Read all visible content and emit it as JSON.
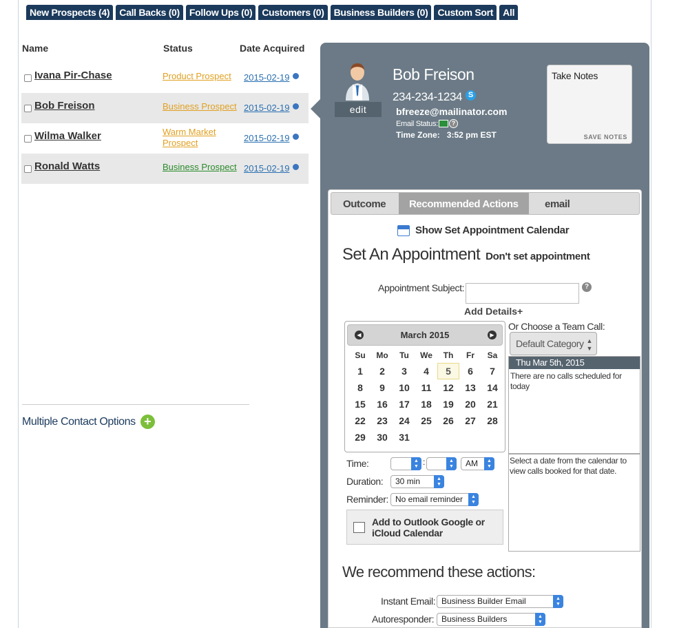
{
  "tabs": [
    {
      "label": "New Prospects (4)"
    },
    {
      "label": "Call Backs (0)"
    },
    {
      "label": "Follow Ups (0)"
    },
    {
      "label": "Customers (0)"
    },
    {
      "label": "Business Builders (0)"
    },
    {
      "label": "Custom Sort"
    },
    {
      "label": "All"
    }
  ],
  "columns": {
    "name": "Name",
    "status": "Status",
    "date": "Date Acquired"
  },
  "contacts": [
    {
      "name": "Ivana Pir-Chase",
      "status": "Product Prospect",
      "status_color": "#e0a020",
      "date": "2015-02-19"
    },
    {
      "name": "Bob Freison",
      "status": "Business Prospect",
      "status_color": "#e0a020",
      "date": "2015-02-19"
    },
    {
      "name": "Wilma Walker",
      "status": "Warm Market Prospect",
      "status_color": "#e0a020",
      "date": "2015-02-19"
    },
    {
      "name": "Ronald Watts",
      "status": "Business Prospect",
      "status_color": "#2a8a2a",
      "date": "2015-02-19"
    }
  ],
  "multiple_contact_options": "Multiple Contact Options",
  "contact": {
    "edit_label": "edit",
    "name": "Bob Freison",
    "phone": "234-234-1234",
    "email": "bfreeze@mailinator.com",
    "email_status_label": "Email Status:",
    "time_zone_label": "Time Zone:",
    "time_zone_value": "3:52 pm EST"
  },
  "notes": {
    "placeholder": "Take Notes",
    "save_label": "SAVE NOTES"
  },
  "subtabs": [
    {
      "label": "Outcome"
    },
    {
      "label": "Recommended Actions"
    },
    {
      "label": "email"
    }
  ],
  "show_calendar_label": "Show Set Appointment Calendar",
  "appointment": {
    "title": "Set An Appointment",
    "dont_set": "Don't set appointment",
    "subject_label": "Appointment Subject:",
    "add_details": "Add Details+",
    "team_call_label": "Or Choose a Team Call:",
    "team_category": "Default Category",
    "calls_date": "Thu Mar 5th, 2015",
    "no_calls": "There are no calls scheduled for today",
    "select_hint": "Select a date from the calendar to view calls booked for that date."
  },
  "calendar": {
    "month": "March 2015",
    "dow": [
      "Su",
      "Mo",
      "Tu",
      "We",
      "Th",
      "Fr",
      "Sa"
    ],
    "weeks": [
      [
        "1",
        "2",
        "3",
        "4",
        "5",
        "6",
        "7"
      ],
      [
        "8",
        "9",
        "10",
        "11",
        "12",
        "13",
        "14"
      ],
      [
        "15",
        "16",
        "17",
        "18",
        "19",
        "20",
        "21"
      ],
      [
        "22",
        "23",
        "24",
        "25",
        "26",
        "27",
        "28"
      ],
      [
        "29",
        "30",
        "31",
        "",
        "",
        "",
        ""
      ]
    ],
    "today": "5"
  },
  "form": {
    "time_label": "Time:",
    "ampm": "AM",
    "duration_label": "Duration:",
    "duration_value": "30 min",
    "reminder_label": "Reminder:",
    "reminder_value": "No email reminder",
    "outlook_label": "Add to Outlook Google or iCloud Calendar"
  },
  "recommend": {
    "title": "We recommend these actions:",
    "instant_email_label": "Instant Email:",
    "instant_email_value": "Business Builder Email",
    "autoresponder_label": "Autoresponder:",
    "autoresponder_value": "Business Builders"
  },
  "colors": {
    "tab_bg": "#1b3a5c",
    "panel_bg": "#6b7a86",
    "link": "#2a6fb0"
  }
}
